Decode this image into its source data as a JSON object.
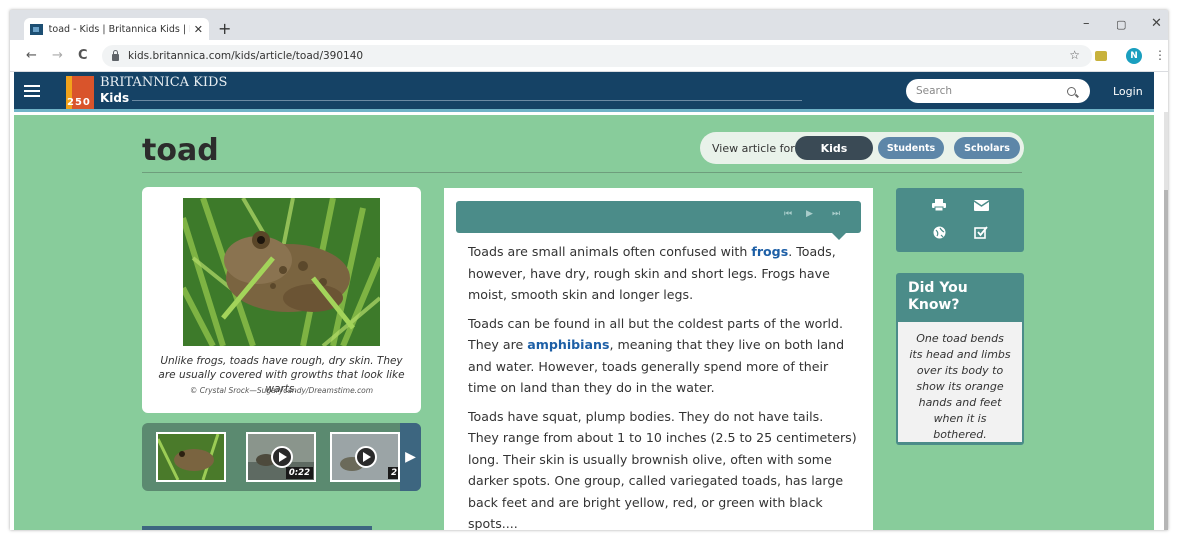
{
  "browser": {
    "tab_title": "toad - Kids | Britannica Kids | Ho",
    "tab_close": "✕",
    "new_tab": "+",
    "url": "kids.britannica.com/kids/article/toad/390140",
    "profile_initial": "N",
    "back": "←",
    "forward": "→",
    "reload": "C",
    "star": "☆",
    "menu": "⋮",
    "minimize": "–",
    "restore": "▢",
    "close": "✕"
  },
  "header": {
    "brand_top": "BRITANNICA KIDS",
    "brand_bottom": "Kids",
    "logo_number": "250",
    "search_placeholder": "Search",
    "login": "Login"
  },
  "article": {
    "title": "toad",
    "view_for_label": "View article for:",
    "levels": [
      "Kids",
      "Students",
      "Scholars"
    ],
    "selected_level": "Kids",
    "image_caption": "Unlike frogs, toads have rough, dry skin. They are usually covered with growths that look like warts.",
    "image_credit": "© Crystal Srock—Sugarycandy/Dreamstime.com",
    "video_duration": "0:22",
    "video_duration_partial": "2",
    "audio_controls": [
      "⏮",
      "▶",
      "⏭"
    ],
    "paragraphs": [
      {
        "before": "Toads are small animals often confused with ",
        "link": "frogs",
        "after": ". Toads, however, have dry, rough skin and short legs. Frogs have moist, smooth skin and longer legs."
      },
      {
        "before": "Toads can be found in all but the coldest parts of the world. They are ",
        "link": "amphibians",
        "after": ", meaning that they live on both land and water. However, toads generally spend more of their time on land than they do in the water."
      },
      {
        "before": "Toads have squat, plump bodies. They do not have tails. They range from about 1 to 10 inches (2.5 to 25 centimeters) long. Their skin is usually brownish olive, often with some darker spots. One group, called variegated toads, has large back feet and are bright yellow, red, or green with black spots....",
        "link": "",
        "after": ""
      }
    ]
  },
  "sidebar": {
    "tools": [
      "print-icon",
      "email-icon",
      "citation-icon",
      "checklist-icon"
    ],
    "did_you_know_title": "Did You Know?",
    "did_you_know_text": "One toad bends its head and limbs over its body to show its orange hands and feet when it is bothered."
  },
  "colors": {
    "header_bg": "#154265",
    "page_bg": "#88cc9b",
    "teal": "#4b8c89",
    "link": "#1d5fa6",
    "kids_btn": "#3a4a55",
    "level_btn": "#5d86a8"
  }
}
